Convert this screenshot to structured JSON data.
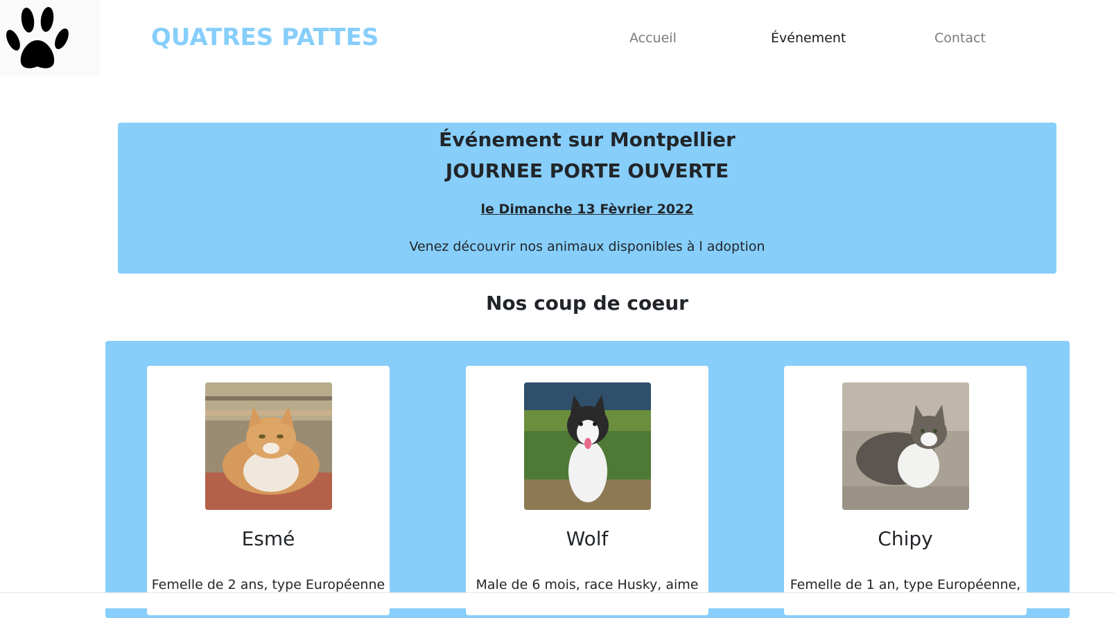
{
  "header": {
    "brand": "QUATRES PATTES",
    "logo_icon": "paw-print-icon",
    "nav": [
      {
        "label": "Accueil",
        "active": false
      },
      {
        "label": "Événement",
        "active": true
      },
      {
        "label": "Contact",
        "active": false
      }
    ]
  },
  "event": {
    "title": "Événement sur Montpellier",
    "subtitle": "JOURNEE PORTE OUVERTE",
    "date": "le Dimanche 13 Fèvrier 2022",
    "text": "Venez découvrir nos animaux disponibles à l adoption"
  },
  "favorites": {
    "title": "Nos coup de coeur",
    "cards": [
      {
        "name": "Esmé",
        "description": "Femelle de 2 ans, type Européenne",
        "photo": "orange-white-cat-photo"
      },
      {
        "name": "Wolf",
        "description": "Male de 6 mois, race Husky, aime",
        "photo": "husky-puppy-photo"
      },
      {
        "name": "Chipy",
        "description": "Femelle de 1 an, type Européenne,",
        "photo": "grey-white-cat-photo"
      }
    ]
  },
  "colors": {
    "brand": "#87cefa",
    "panel": "#87cefa",
    "nav_inactive": "#7a7a7a",
    "nav_active": "#1a1a1a"
  }
}
